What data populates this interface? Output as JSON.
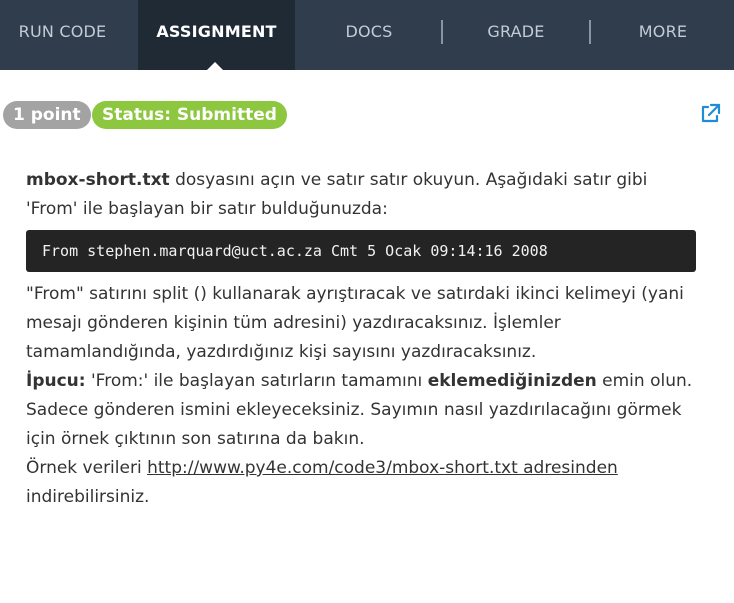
{
  "nav": {
    "tabs": [
      {
        "label": "RUN CODE"
      },
      {
        "label": "ASSIGNMENT"
      },
      {
        "label": "DOCS"
      },
      {
        "label": "GRADE"
      },
      {
        "label": "MORE"
      }
    ],
    "active_tab": "ASSIGNMENT"
  },
  "badges": {
    "points": "1 point",
    "status": "Status: Submitted"
  },
  "icons": {
    "external": "external-link-icon"
  },
  "colors": {
    "nav_bg": "#2f3d4c",
    "nav_active_bg": "#1f2a35",
    "status_green": "#8dc63f",
    "points_gray": "#a3a3a3",
    "icon_blue": "#1f8dd6",
    "code_bg": "#242424"
  },
  "content": {
    "intro_bold": "mbox-short.txt",
    "intro_rest": " dosyasını açın ve satır satır okuyun. Aşağıdaki satır gibi 'From' ile başlayan bir satır bulduğunuzda:",
    "code_line": "From stephen.marquard@uct.ac.za Cmt 5 Ocak 09:14:16 2008",
    "para2": "\"From\" satırını split () kullanarak ayrıştıracak ve satırdaki ikinci kelimeyi (yani mesajı gönderen kişinin tüm adresini) yazdıracaksınız. İşlemler tamamlandığında, yazdırdığınız kişi sayısını yazdıracaksınız.",
    "hint_label": "İpucu:",
    "hint_text1": " 'From:' ile başlayan satırların tamamını ",
    "hint_bold": "eklemediğinizden",
    "hint_text2": " emin olun. Sadece gönderen ismini ekleyeceksiniz. Sayımın nasıl yazdırılacağını görmek için örnek çıktının son satırına da bakın.",
    "sample_prefix": "Örnek verileri ",
    "sample_link": "http://www.py4e.com/code3/mbox-short.txt adresinden",
    "sample_suffix": " indirebilirsiniz."
  }
}
